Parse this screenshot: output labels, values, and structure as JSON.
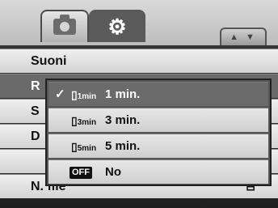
{
  "tabs": [
    {
      "name": "camera",
      "icon": "camera-icon"
    },
    {
      "name": "setup",
      "icon": "tools-icon",
      "glyph": "⚙"
    }
  ],
  "scroll_indicator": "▲ ▼",
  "menu": {
    "items": [
      {
        "label": "Suoni",
        "value": ""
      },
      {
        "label": "R",
        "value": ""
      },
      {
        "label": "S",
        "value": ""
      },
      {
        "label": "D",
        "value": ""
      },
      {
        "label": "",
        "value": ""
      },
      {
        "label": "N. file",
        "value": "⊟"
      }
    ]
  },
  "popup": {
    "options": [
      {
        "check": "✓",
        "icon_main": "▯",
        "icon_sub": "1min",
        "label": "1 min."
      },
      {
        "check": "",
        "icon_main": "▯",
        "icon_sub": "3min",
        "label": "3 min."
      },
      {
        "check": "",
        "icon_main": "▯",
        "icon_sub": "5min",
        "label": "5 min."
      },
      {
        "check": "",
        "icon_main": "OFF",
        "icon_sub": "",
        "label": "No"
      }
    ]
  }
}
